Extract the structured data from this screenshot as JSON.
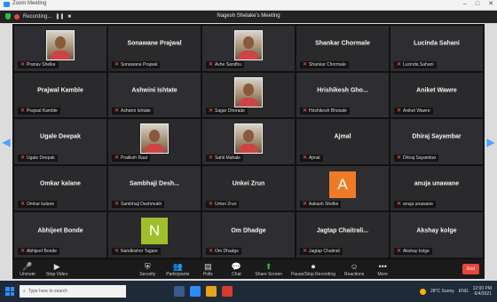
{
  "window": {
    "title": "Zoom Meeting",
    "controls": [
      "–",
      "□",
      "✕"
    ]
  },
  "topbar": {
    "recording_label": "Recording...",
    "pause_glyph": "❚❚",
    "stop_glyph": "■",
    "meeting_title": "Nagesh Shelake's Meeting"
  },
  "participants": [
    {
      "name": "",
      "label": "Pranav Shelke",
      "type": "photo"
    },
    {
      "name": "Sonawane Prajwal",
      "label": "Sonawane Prajwal",
      "type": "name"
    },
    {
      "name": "",
      "label": "Avhe Sandhu",
      "type": "photo"
    },
    {
      "name": "Shankar Chormale",
      "label": "Shankar Chormale",
      "type": "name"
    },
    {
      "name": "Lucinda Sahani",
      "label": "Lucinda Sahani",
      "type": "name"
    },
    {
      "name": "Prajwal Kamble",
      "label": "Prajwal Kamble",
      "type": "name"
    },
    {
      "name": "Ashwini Ishtate",
      "label": "Ashwini Ishtate",
      "type": "name"
    },
    {
      "name": "",
      "label": "Sagar Dhorade",
      "type": "photo"
    },
    {
      "name": "Hrishikesh Gho...",
      "label": "Hrishikesh Bhosale",
      "type": "name"
    },
    {
      "name": "Aniket Wawre",
      "label": "Aniket Wawre",
      "type": "name"
    },
    {
      "name": "Ugale Deepak",
      "label": "Ugale Deepak",
      "type": "name"
    },
    {
      "name": "",
      "label": "Pratiksh Raut",
      "type": "photo"
    },
    {
      "name": "",
      "label": "Sahil Mahale",
      "type": "photo"
    },
    {
      "name": "Ajmal",
      "label": "Ajmal",
      "type": "name"
    },
    {
      "name": "Dhiraj Sayambar",
      "label": "Dhiraj Sayambar",
      "type": "name"
    },
    {
      "name": "Omkar kalane",
      "label": "Omkar kalane",
      "type": "name"
    },
    {
      "name": "Sambhaji Desh...",
      "label": "Sambhaji Deshmukh",
      "type": "name"
    },
    {
      "name": "Unkei Zrun",
      "label": "Unkei Zrun",
      "type": "name"
    },
    {
      "name": "",
      "label": "Aakash Shelke",
      "type": "avatar",
      "initial": "A"
    },
    {
      "name": "anuja unawane",
      "label": "anuja unawane",
      "type": "name"
    },
    {
      "name": "Abhijeet Bonde",
      "label": "Abhijeet Bonde",
      "type": "name"
    },
    {
      "name": "",
      "label": "Nandkishor Tagare",
      "type": "avatar",
      "initial": "N"
    },
    {
      "name": "Om Dhadge",
      "label": "Om Dhadge",
      "type": "name"
    },
    {
      "name": "Jagtap Chaitrali...",
      "label": "Jagtap Chaitrali",
      "type": "name"
    },
    {
      "name": "Akshay kolge",
      "label": "Akshay kolge",
      "type": "name"
    }
  ],
  "toolbar": {
    "left": [
      {
        "icon": "mic-icon",
        "glyph": "🎤",
        "label": "Unmute"
      },
      {
        "icon": "video-icon",
        "glyph": "▶",
        "label": "Stop Video"
      }
    ],
    "center": [
      {
        "icon": "security-icon",
        "glyph": "⛨",
        "label": "Security"
      },
      {
        "icon": "participants-icon",
        "glyph": "👥",
        "label": "Participants"
      },
      {
        "icon": "polls-icon",
        "glyph": "▤",
        "label": "Polls"
      },
      {
        "icon": "chat-icon",
        "glyph": "💬",
        "label": "Chat"
      },
      {
        "icon": "share-screen-icon",
        "glyph": "⬆",
        "label": "Share Screen"
      },
      {
        "icon": "record-icon",
        "glyph": "⏺",
        "label": "Pause/Stop Recording"
      },
      {
        "icon": "reactions-icon",
        "glyph": "☺",
        "label": "Reactions"
      },
      {
        "icon": "more-icon",
        "glyph": "•••",
        "label": "More"
      }
    ],
    "end_label": "End"
  },
  "taskbar": {
    "search_placeholder": "Type here to search",
    "weather": "28°C Sunny",
    "lang": "ENG",
    "time": "12:00 PM",
    "date": "6/4/2021"
  },
  "colors": {
    "end": "#e5483b",
    "avatar_a": "#f07b27",
    "avatar_n": "#9fbf2a",
    "shield": "#27c23f"
  }
}
